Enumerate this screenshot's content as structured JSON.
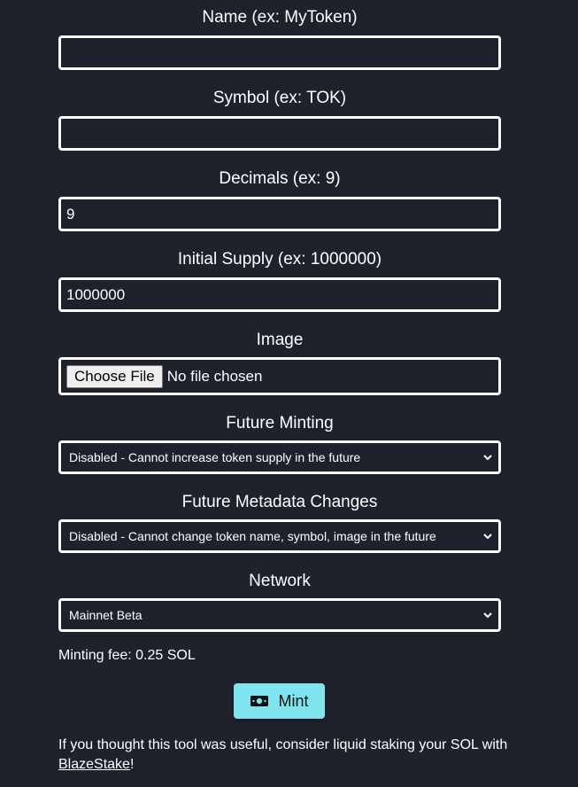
{
  "form": {
    "name": {
      "label": "Name (ex: MyToken)",
      "value": ""
    },
    "symbol": {
      "label": "Symbol (ex: TOK)",
      "value": ""
    },
    "decimals": {
      "label": "Decimals (ex: 9)",
      "value": "9"
    },
    "initial_supply": {
      "label": "Initial Supply (ex: 1000000)",
      "value": "1000000"
    },
    "image": {
      "label": "Image",
      "button_label": "Choose File",
      "status": "No file chosen"
    },
    "future_minting": {
      "label": "Future Minting",
      "selected": "Disabled - Cannot increase token supply in the future"
    },
    "future_metadata": {
      "label": "Future Metadata Changes",
      "selected": "Disabled - Cannot change token name, symbol, image in the future"
    },
    "network": {
      "label": "Network",
      "selected": "Mainnet Beta"
    }
  },
  "fee_text": "Minting fee: 0.25 SOL",
  "mint_button": {
    "label": "Mint",
    "icon": "money-bill-icon",
    "color": "#7fe4ee"
  },
  "footer": {
    "text_before": "If you thought this tool was useful, consider liquid staking your SOL with ",
    "link_text": "BlazeStake",
    "text_after": "!"
  },
  "colors": {
    "background": "#1f212c",
    "border": "#ffffff",
    "accent": "#7fe4ee"
  }
}
